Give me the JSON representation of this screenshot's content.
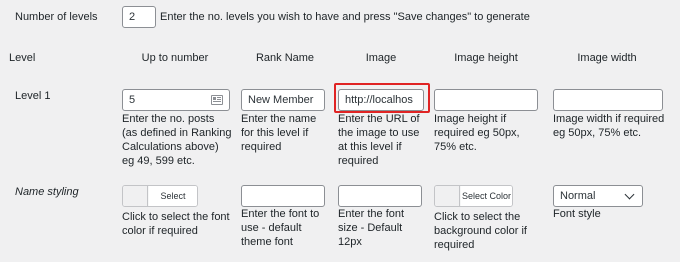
{
  "levels": {
    "label": "Number of levels",
    "value": "2",
    "hint": "Enter the no. levels you wish to have and press \"Save changes\" to generate"
  },
  "headers": {
    "level": "Level",
    "up_to": "Up to number",
    "rank": "Rank Name",
    "image": "Image",
    "image_height": "Image height",
    "image_width": "Image width"
  },
  "row1": {
    "label": "Level 1",
    "up_to_value": "5",
    "up_to_desc": [
      "Enter the no. posts",
      "(as defined in Ranking",
      "Calculations above)",
      "eg 49, 599 etc."
    ],
    "rank_value": "New Member",
    "rank_desc": [
      "Enter the name",
      "for this level if",
      "required"
    ],
    "image_value": "http://localhos",
    "image_desc": [
      "Enter the URL of",
      "the image to use",
      "at this level if",
      "required"
    ],
    "height_value": "",
    "height_desc": [
      "Image height if",
      "required eg 50px,",
      "75% etc."
    ],
    "width_value": "",
    "width_desc": [
      "Image width if required",
      "eg 50px, 75% etc."
    ]
  },
  "styling": {
    "label": "Name styling",
    "font_color_button": "Select Color",
    "font_color_desc": [
      "Click to select the font",
      "color if required"
    ],
    "font_desc": [
      "Enter the font to",
      "use - default",
      "theme font"
    ],
    "font_size_desc": [
      "Enter the font",
      "size - Default",
      "12px"
    ],
    "bg_color_button": "Select Color",
    "bg_color_desc": [
      "Click to select the",
      "background color if",
      "required"
    ],
    "font_style_value": "Normal",
    "font_style_desc": "Font style"
  },
  "colors": {
    "highlight": "#e02424"
  }
}
